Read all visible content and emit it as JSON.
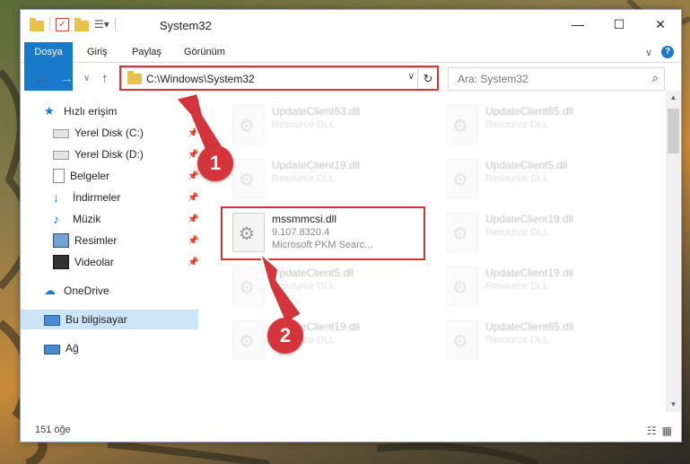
{
  "window": {
    "title": "System32",
    "controls": {
      "minimize": "—",
      "maximize": "☐",
      "close": "✕"
    }
  },
  "ribbon": {
    "tabs": [
      "Dosya",
      "Giriş",
      "Paylaş",
      "Görünüm"
    ],
    "expand_icon": "∨",
    "help_icon": "?"
  },
  "nav": {
    "back": "←",
    "forward": "→",
    "recent": "∨",
    "up": "↑",
    "address": "C:\\Windows\\System32",
    "address_dropdown": "∨",
    "refresh": "↻",
    "search_placeholder": "Ara: System32",
    "search_icon": "⌕"
  },
  "sidebar": {
    "items": [
      {
        "label": "Hızlı erişim",
        "icon": "star-icon"
      },
      {
        "label": "Yerel Disk (C:)",
        "icon": "drive-icon",
        "pinned": true
      },
      {
        "label": "Yerel Disk (D:)",
        "icon": "drive-icon",
        "pinned": true
      },
      {
        "label": "Belgeler",
        "icon": "documents-icon",
        "pinned": true
      },
      {
        "label": "İndirmeler",
        "icon": "download-icon",
        "pinned": true
      },
      {
        "label": "Müzik",
        "icon": "music-icon",
        "pinned": true
      },
      {
        "label": "Resimler",
        "icon": "pictures-icon",
        "pinned": true
      },
      {
        "label": "Videolar",
        "icon": "videos-icon",
        "pinned": true
      },
      {
        "label": "OneDrive",
        "icon": "cloud-icon"
      },
      {
        "label": "Bu bilgisayar",
        "icon": "computer-icon",
        "selected": true
      },
      {
        "label": "Ağ",
        "icon": "network-icon"
      }
    ],
    "pin_glyph": "📌"
  },
  "files": [
    {
      "name": "UpdateClient63.dll",
      "desc": "Resource DLL"
    },
    {
      "name": "UpdateClient65.dll",
      "desc": "Resource DLL"
    },
    {
      "name": "UpdateClient19.dll",
      "desc": "Resource DLL"
    },
    {
      "name": "UpdateClient5.dll",
      "desc": "Resource DLL"
    },
    {
      "name": "mssmmcsi.dll",
      "version": "9.107.8320.4",
      "desc": "Microsoft PKM Searc..."
    },
    {
      "name": "UpdateClient19.dll",
      "desc": "Resource DLL"
    },
    {
      "name": "UpdateClient5.dll",
      "desc": "Resource DLL"
    },
    {
      "name": "UpdateClient19.dll",
      "desc": "Resource DLL"
    },
    {
      "name": "UpdateClient19.dll",
      "desc": "Resource DLL"
    },
    {
      "name": "UpdateClient65.dll",
      "desc": "Resource DLL"
    }
  ],
  "status": {
    "count": "151 öğe",
    "view_details": "☷",
    "view_icons": "▦"
  },
  "callouts": [
    "1",
    "2"
  ],
  "colors": {
    "accent": "#1979ca",
    "highlight": "#d4343a",
    "selected": "#cce4f7"
  }
}
